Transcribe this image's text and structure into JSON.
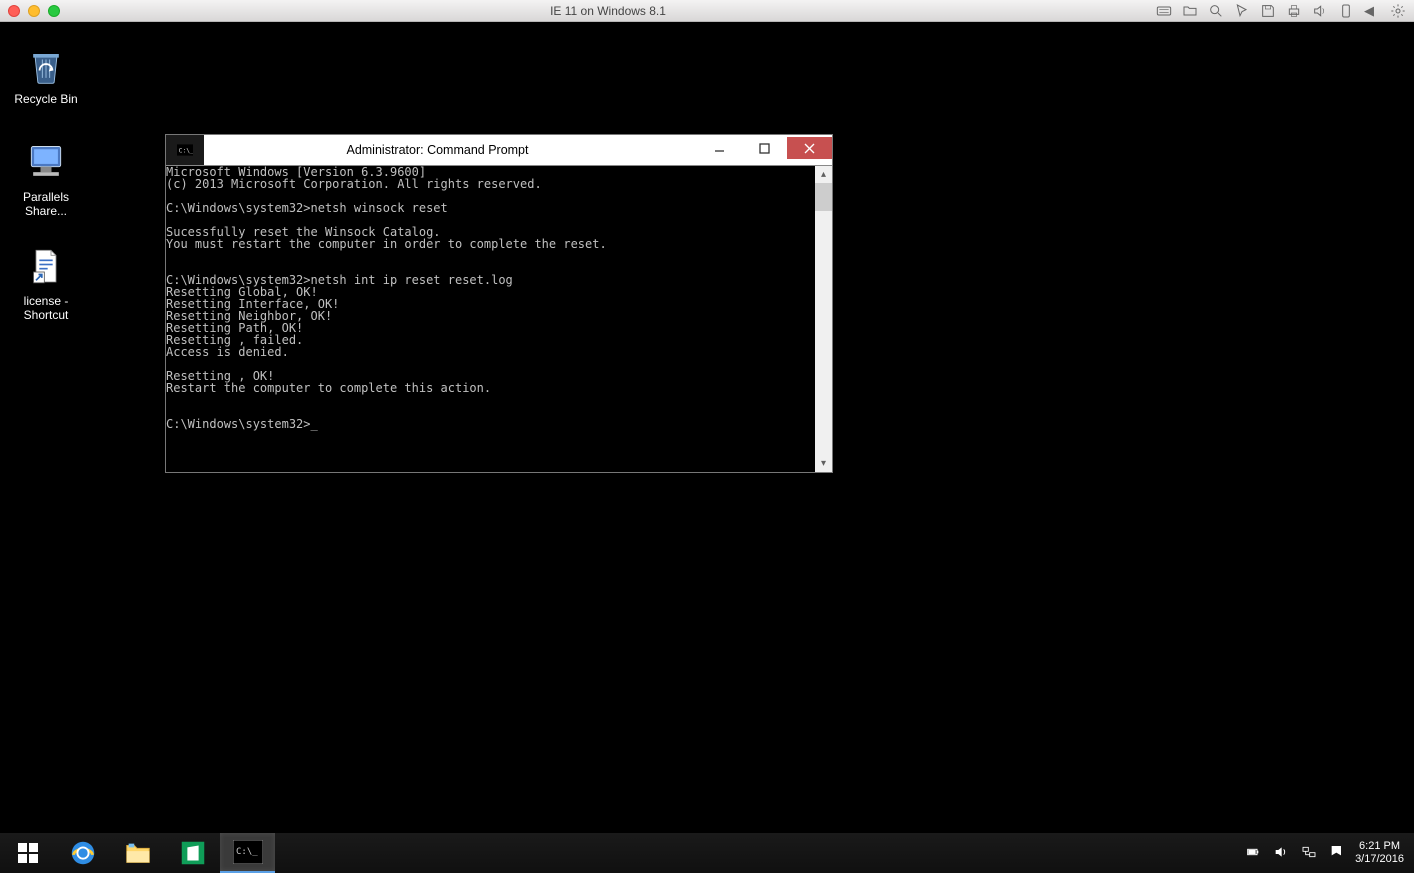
{
  "mac": {
    "title": "IE 11 on Windows 8.1"
  },
  "desktop": {
    "icons": [
      {
        "label": "Recycle Bin"
      },
      {
        "label": "Parallels Share..."
      },
      {
        "label": "license - Shortcut"
      }
    ]
  },
  "cmd": {
    "title": "Administrator: Command Prompt",
    "body": "Microsoft Windows [Version 6.3.9600]\n(c) 2013 Microsoft Corporation. All rights reserved.\n\nC:\\Windows\\system32>netsh winsock reset\n\nSucessfully reset the Winsock Catalog.\nYou must restart the computer in order to complete the reset.\n\n\nC:\\Windows\\system32>netsh int ip reset reset.log\nResetting Global, OK!\nResetting Interface, OK!\nResetting Neighbor, OK!\nResetting Path, OK!\nResetting , failed.\nAccess is denied.\n\nResetting , OK!\nRestart the computer to complete this action.\n\n\nC:\\Windows\\system32>_"
  },
  "taskbar": {
    "time": "6:21 PM",
    "date": "3/17/2016"
  }
}
